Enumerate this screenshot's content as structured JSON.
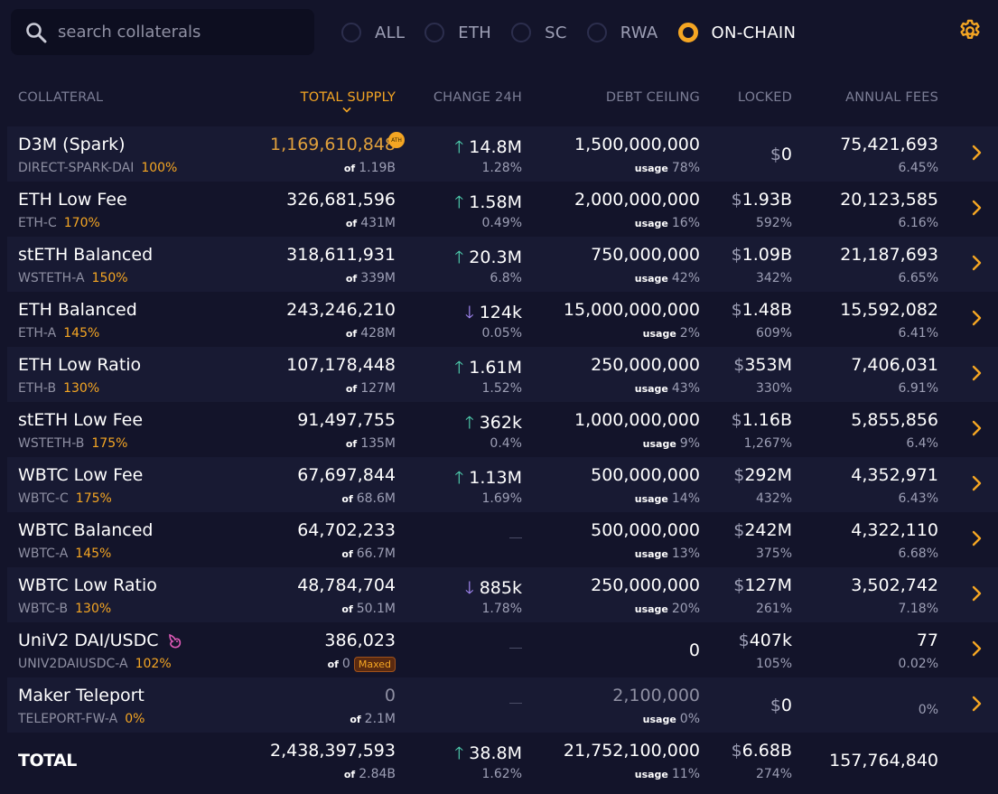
{
  "search": {
    "placeholder": "search collaterals"
  },
  "filters": [
    {
      "label": "ALL",
      "active": false
    },
    {
      "label": "ETH",
      "active": false
    },
    {
      "label": "SC",
      "active": false
    },
    {
      "label": "RWA",
      "active": false
    },
    {
      "label": "ON-CHAIN",
      "active": true
    }
  ],
  "colors": {
    "accent": "#f5a623",
    "up": "#4fd1b0",
    "down": "#a78bfa"
  },
  "headers": {
    "collateral": "COLLATERAL",
    "total_supply": "TOTAL SUPPLY",
    "change_24h": "CHANGE 24H",
    "debt_ceiling": "DEBT CEILING",
    "locked": "LOCKED",
    "annual_fees": "ANNUAL FEES"
  },
  "rows": [
    {
      "name": "D3M (Spark)",
      "ilk": "DIRECT-SPARK-DAI",
      "ratio": "100%",
      "supply": "1,169,610,848",
      "supply_of": "1.19B",
      "ath": "ATH",
      "change": "14.8M",
      "change_dir": "up",
      "change_pct": "1.28%",
      "ceiling": "1,500,000,000",
      "usage": "78%",
      "locked": "0",
      "locked_pct": "",
      "fees": "75,421,693",
      "fees_pct": "6.45%"
    },
    {
      "name": "ETH Low Fee",
      "ilk": "ETH-C",
      "ratio": "170%",
      "supply": "326,681,596",
      "supply_of": "431M",
      "change": "1.58M",
      "change_dir": "up",
      "change_pct": "0.49%",
      "ceiling": "2,000,000,000",
      "usage": "16%",
      "locked": "1.93B",
      "locked_pct": "592%",
      "fees": "20,123,585",
      "fees_pct": "6.16%"
    },
    {
      "name": "stETH Balanced",
      "ilk": "WSTETH-A",
      "ratio": "150%",
      "supply": "318,611,931",
      "supply_of": "339M",
      "change": "20.3M",
      "change_dir": "up",
      "change_pct": "6.8%",
      "ceiling": "750,000,000",
      "usage": "42%",
      "locked": "1.09B",
      "locked_pct": "342%",
      "fees": "21,187,693",
      "fees_pct": "6.65%"
    },
    {
      "name": "ETH Balanced",
      "ilk": "ETH-A",
      "ratio": "145%",
      "supply": "243,246,210",
      "supply_of": "428M",
      "change": "124k",
      "change_dir": "down",
      "change_pct": "0.05%",
      "ceiling": "15,000,000,000",
      "usage": "2%",
      "locked": "1.48B",
      "locked_pct": "609%",
      "fees": "15,592,082",
      "fees_pct": "6.41%"
    },
    {
      "name": "ETH Low Ratio",
      "ilk": "ETH-B",
      "ratio": "130%",
      "supply": "107,178,448",
      "supply_of": "127M",
      "change": "1.61M",
      "change_dir": "up",
      "change_pct": "1.52%",
      "ceiling": "250,000,000",
      "usage": "43%",
      "locked": "353M",
      "locked_pct": "330%",
      "fees": "7,406,031",
      "fees_pct": "6.91%"
    },
    {
      "name": "stETH Low Fee",
      "ilk": "WSTETH-B",
      "ratio": "175%",
      "supply": "91,497,755",
      "supply_of": "135M",
      "change": "362k",
      "change_dir": "up",
      "change_pct": "0.4%",
      "ceiling": "1,000,000,000",
      "usage": "9%",
      "locked": "1.16B",
      "locked_pct": "1,267%",
      "fees": "5,855,856",
      "fees_pct": "6.4%"
    },
    {
      "name": "WBTC Low Fee",
      "ilk": "WBTC-C",
      "ratio": "175%",
      "supply": "67,697,844",
      "supply_of": "68.6M",
      "change": "1.13M",
      "change_dir": "up",
      "change_pct": "1.69%",
      "ceiling": "500,000,000",
      "usage": "14%",
      "locked": "292M",
      "locked_pct": "432%",
      "fees": "4,352,971",
      "fees_pct": "6.43%"
    },
    {
      "name": "WBTC Balanced",
      "ilk": "WBTC-A",
      "ratio": "145%",
      "supply": "64,702,233",
      "supply_of": "66.7M",
      "change": "",
      "change_dir": "none",
      "change_pct": "",
      "ceiling": "500,000,000",
      "usage": "13%",
      "locked": "242M",
      "locked_pct": "375%",
      "fees": "4,322,110",
      "fees_pct": "6.68%"
    },
    {
      "name": "WBTC Low Ratio",
      "ilk": "WBTC-B",
      "ratio": "130%",
      "supply": "48,784,704",
      "supply_of": "50.1M",
      "change": "885k",
      "change_dir": "down",
      "change_pct": "1.78%",
      "ceiling": "250,000,000",
      "usage": "20%",
      "locked": "127M",
      "locked_pct": "261%",
      "fees": "3,502,742",
      "fees_pct": "7.18%"
    },
    {
      "name": "UniV2 DAI/USDC",
      "ilk": "UNIV2DAIUSDC-A",
      "ratio": "102%",
      "supply": "386,023",
      "supply_of": "0",
      "maxed": "Maxed",
      "change": "",
      "change_dir": "none",
      "change_pct": "",
      "ceiling": "0",
      "usage": "",
      "locked": "407k",
      "locked_pct": "105%",
      "fees": "77",
      "fees_pct": "0.02%"
    },
    {
      "name": "Maker Teleport",
      "ilk": "TELEPORT-FW-A",
      "ratio": "0%",
      "supply": "0",
      "supply_of": "2.1M",
      "change": "",
      "change_dir": "none",
      "change_pct": "",
      "ceiling": "2,100,000",
      "usage": "0%",
      "locked": "0",
      "locked_pct": "",
      "fees": "",
      "fees_pct": "0%"
    }
  ],
  "total": {
    "label": "TOTAL",
    "supply": "2,438,397,593",
    "supply_of": "2.84B",
    "change": "38.8M",
    "change_pct": "1.62%",
    "ceiling": "21,752,100,000",
    "usage": "11%",
    "locked": "6.68B",
    "locked_pct": "274%",
    "fees": "157,764,840"
  },
  "labels": {
    "of": "of",
    "usage": "usage",
    "dollar": "$",
    "up_arrow": "🡑",
    "down_arrow": "🡓"
  }
}
